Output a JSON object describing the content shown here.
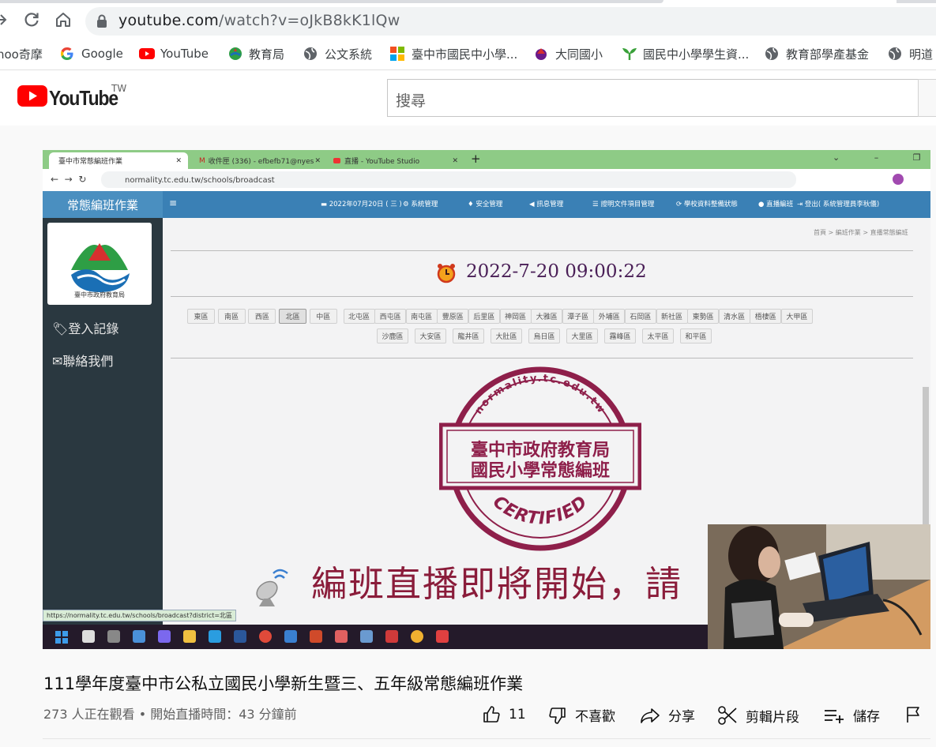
{
  "browser": {
    "url_host": "youtube.com",
    "url_path": "/watch?v=oJkB8kK1lQw",
    "bookmarks": [
      {
        "label": "hoo奇摩",
        "icon": "yahoo-icon"
      },
      {
        "label": "Google",
        "icon": "google-icon"
      },
      {
        "label": "YouTube",
        "icon": "youtube-icon"
      },
      {
        "label": "教育局",
        "icon": "edu-bureau-icon"
      },
      {
        "label": "公文系統",
        "icon": "globe-icon"
      },
      {
        "label": "臺中市國民中小學...",
        "icon": "tiles-icon"
      },
      {
        "label": "大同國小",
        "icon": "school-icon"
      },
      {
        "label": "國民中小學學生資...",
        "icon": "sprout-icon"
      },
      {
        "label": "教育部學產基金",
        "icon": "globe-icon"
      },
      {
        "label": "明道",
        "icon": "globe-icon"
      }
    ]
  },
  "youtube": {
    "logo_text": "YouTube",
    "region": "TW",
    "search_placeholder": "搜尋"
  },
  "video": {
    "inner_tabs": [
      {
        "label": "臺中市常態編班作業"
      },
      {
        "label": "收件匣 (336) - efbefb71@nyes"
      },
      {
        "label": "直播 - YouTube Studio"
      }
    ],
    "inner_url": "normality.tc.edu.tw/schools/broadcast",
    "site_title": "常態編班作業",
    "nav": [
      "2022年07月20日 ( 三 )",
      "系統管理",
      "安全管理",
      "訊息管理",
      "證明文件項目管理",
      "學校資料整備狀態",
      "直播編班",
      "登出( 系統管理員李秋儀)"
    ],
    "logo_caption": "臺中市政府教育局",
    "sidebar": [
      "登入記錄",
      "聯絡我們"
    ],
    "breadcrumb": "首頁 > 編班作業 > 直播常態編班",
    "clock": "2022-7-20 09:00:22",
    "districts_row1": [
      "東區",
      "南區",
      "西區",
      "北區",
      "中區",
      "北屯區",
      "西屯區",
      "南屯區",
      "豐原區",
      "后里區",
      "神岡區",
      "大雅區",
      "潭子區",
      "外埔區",
      "石岡區",
      "新社區",
      "東勢區",
      "清水區",
      "梧棲區",
      "大甲區"
    ],
    "districts_row2": [
      "沙鹿區",
      "大安區",
      "龍井區",
      "大肚區",
      "烏日區",
      "大里區",
      "霧峰區",
      "太平區",
      "和平區"
    ],
    "seal_top": "normality.tc.edu.tw",
    "seal_line1": "臺中市政府教育局",
    "seal_line2": "國民小學常態編班",
    "seal_bottom": "CERTIFIED",
    "announce": "編班直播即將開始，請",
    "status_url": "https://normality.tc.edu.tw/schools/broadcast?district=北區"
  },
  "info": {
    "title": "111學年度臺中市公私立國民小學新生暨三、五年級常態編班作業",
    "meta": "273 人正在觀看 • 開始直播時間：43 分鐘前",
    "like_count": "11",
    "dislike_label": "不喜歡",
    "share_label": "分享",
    "clip_label": "剪輯片段",
    "save_label": "儲存"
  }
}
